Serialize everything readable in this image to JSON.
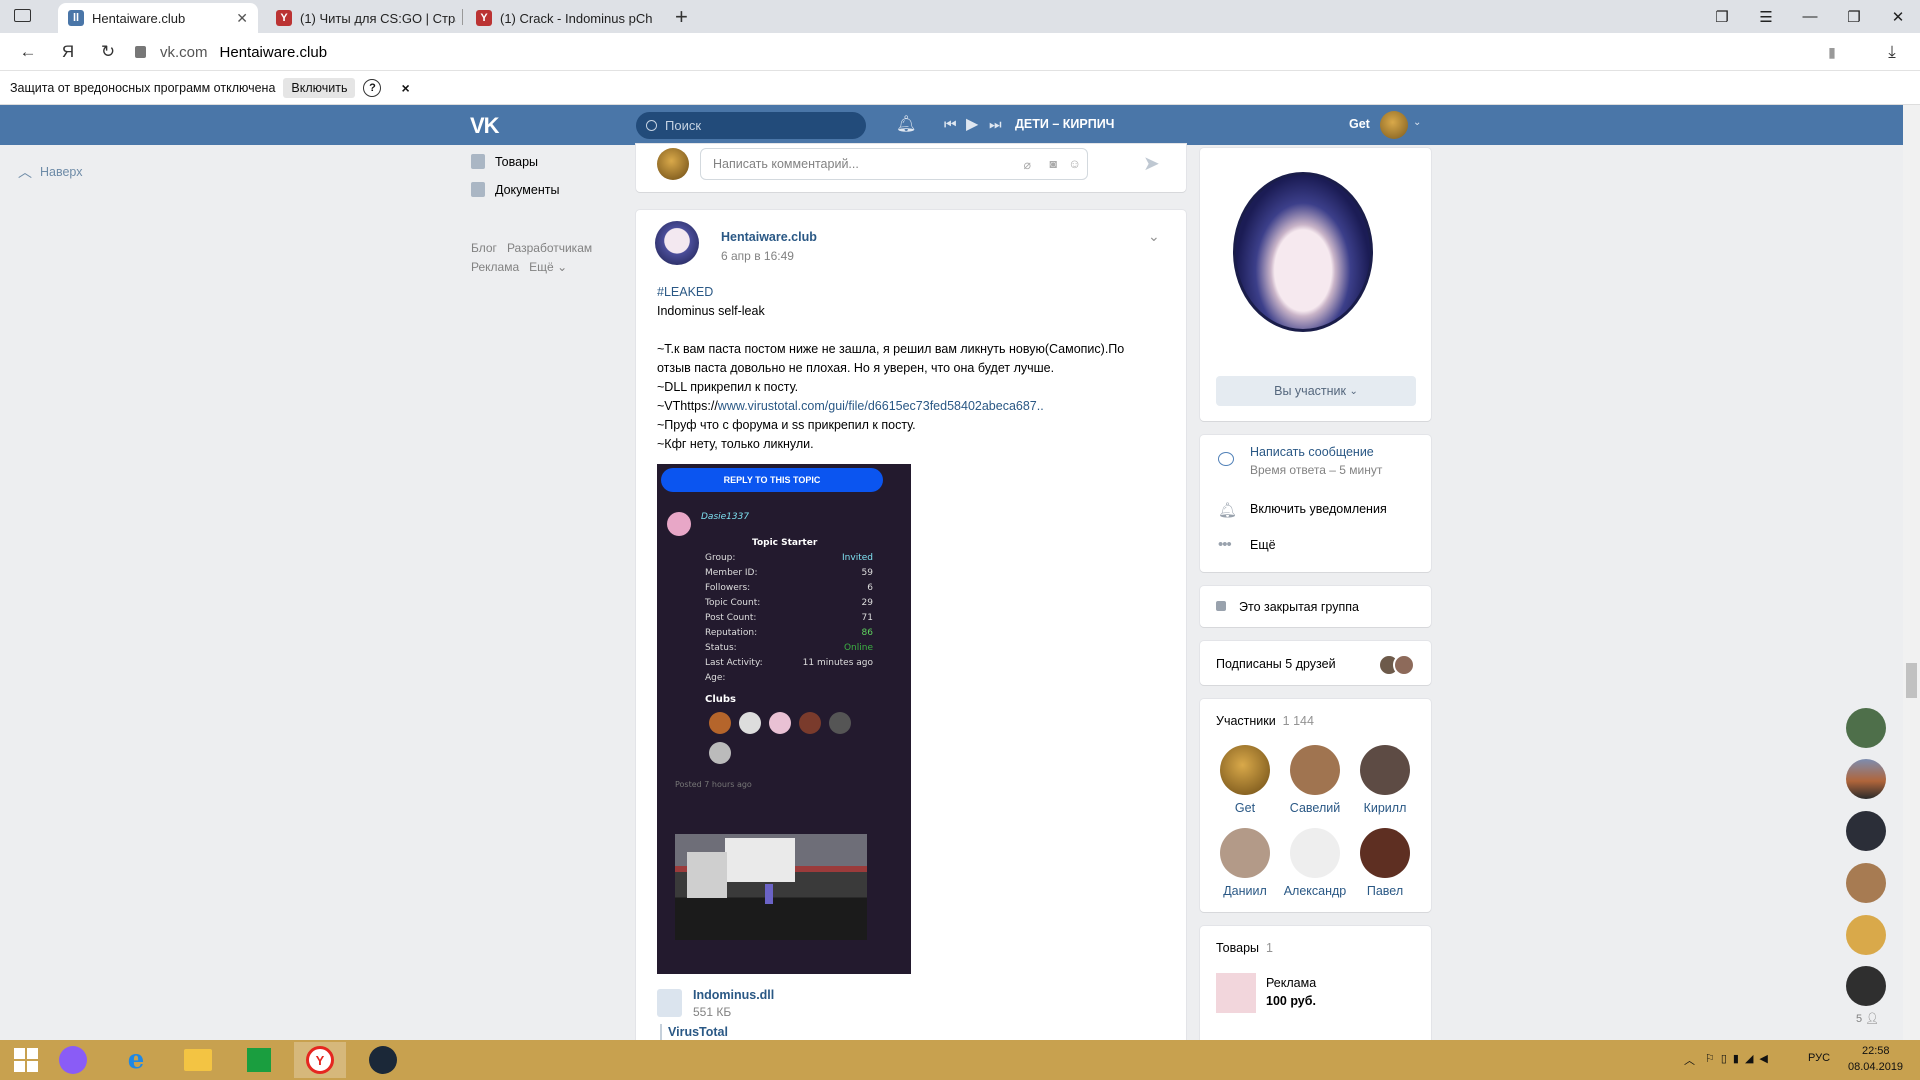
{
  "browser": {
    "tabs": [
      {
        "title": "Hentaiware.club",
        "active": true
      },
      {
        "title": "(1) Читы для CS:GO | Стра",
        "active": false
      },
      {
        "title": "(1) Crack - Indominus pCh",
        "active": false
      }
    ],
    "url_domain": "vk.com",
    "url_title": "Hentaiware.club",
    "yandex_icon": "Я"
  },
  "protection_bar": {
    "text": "Защита от вредоносных программ отключена",
    "button": "Включить",
    "help": "?",
    "close": "×"
  },
  "vk_header": {
    "logo": "VK",
    "search_placeholder": "Поиск",
    "now_playing": "ДЕТИ – КИРПИЧ",
    "user_name": "Get"
  },
  "left_nav": {
    "up_label": "Наверх",
    "items": [
      "Товары",
      "Документы"
    ],
    "footer_row1": [
      "Блог",
      "Разработчикам"
    ],
    "footer_row2": [
      "Реклама",
      "Ещё"
    ]
  },
  "comment_box": {
    "placeholder": "Написать комментарий..."
  },
  "post": {
    "author": "Hentaiware.club",
    "date": "6 апр в 16:49",
    "hashtag": "#LEAKED",
    "title_line": "Indominus self-leak",
    "line1": "~Т.к вам паста постом ниже не зашла, я решил вам ликнуть новую(Самопис).По",
    "line2": "отзыв паста довольно не плохая. Но я уверен, что она будет лучше.",
    "line3": "~DLL прикрепил к посту.",
    "line4_prefix": "~VThttps://",
    "line4_link": "www.virustotal.com/gui/file/d6615ec73fed58402abeca687..",
    "line5": "~Пруф что с форума и ss прикрепил к посту.",
    "line6": "~Кфг нету, только ликнули.",
    "attachment_name": "Indominus.dll",
    "attachment_size": "551 КБ",
    "link_title": "VirusTotal"
  },
  "forum_shot": {
    "reply_button": "REPLY TO THIS TOPIC",
    "username": "Dasie1337",
    "topic_starter": "Topic Starter",
    "rows": [
      {
        "label": "Group:",
        "value": "Invited"
      },
      {
        "label": "Member ID:",
        "value": "59"
      },
      {
        "label": "Followers:",
        "value": "6"
      },
      {
        "label": "Topic Count:",
        "value": "29"
      },
      {
        "label": "Post Count:",
        "value": "71"
      },
      {
        "label": "Reputation:",
        "value": "86"
      },
      {
        "label": "Status:",
        "value": "Online"
      },
      {
        "label": "Last Activity:",
        "value": "11 minutes ago"
      },
      {
        "label": "Age:",
        "value": ""
      }
    ],
    "clubs_title": "Clubs",
    "posted": "Posted 7 hours ago"
  },
  "right_col": {
    "member_button": "Вы участник",
    "write_message": "Написать сообщение",
    "response_time": "Время ответа – 5 минут",
    "notifications": "Включить уведомления",
    "more": "Ещё",
    "closed_group": "Это закрытая группа",
    "friends_subscribed": "Подписаны 5 друзей",
    "members_title": "Участники",
    "members_count": "1 144",
    "members": [
      "Get",
      "Савелий",
      "Кирилл",
      "Даниил",
      "Александр",
      "Павел"
    ],
    "goods_title": "Товары",
    "goods_count": "1",
    "goods_item_name": "Реклама",
    "goods_item_price": "100 руб."
  },
  "chat_strip": {
    "count": "5"
  },
  "taskbar": {
    "lang": "РУС",
    "time": "22:58",
    "date": "08.04.2019"
  },
  "colors": {
    "vk_blue": "#4a76a8",
    "link": "#2a5885",
    "taskbar": "#c8a14f"
  }
}
